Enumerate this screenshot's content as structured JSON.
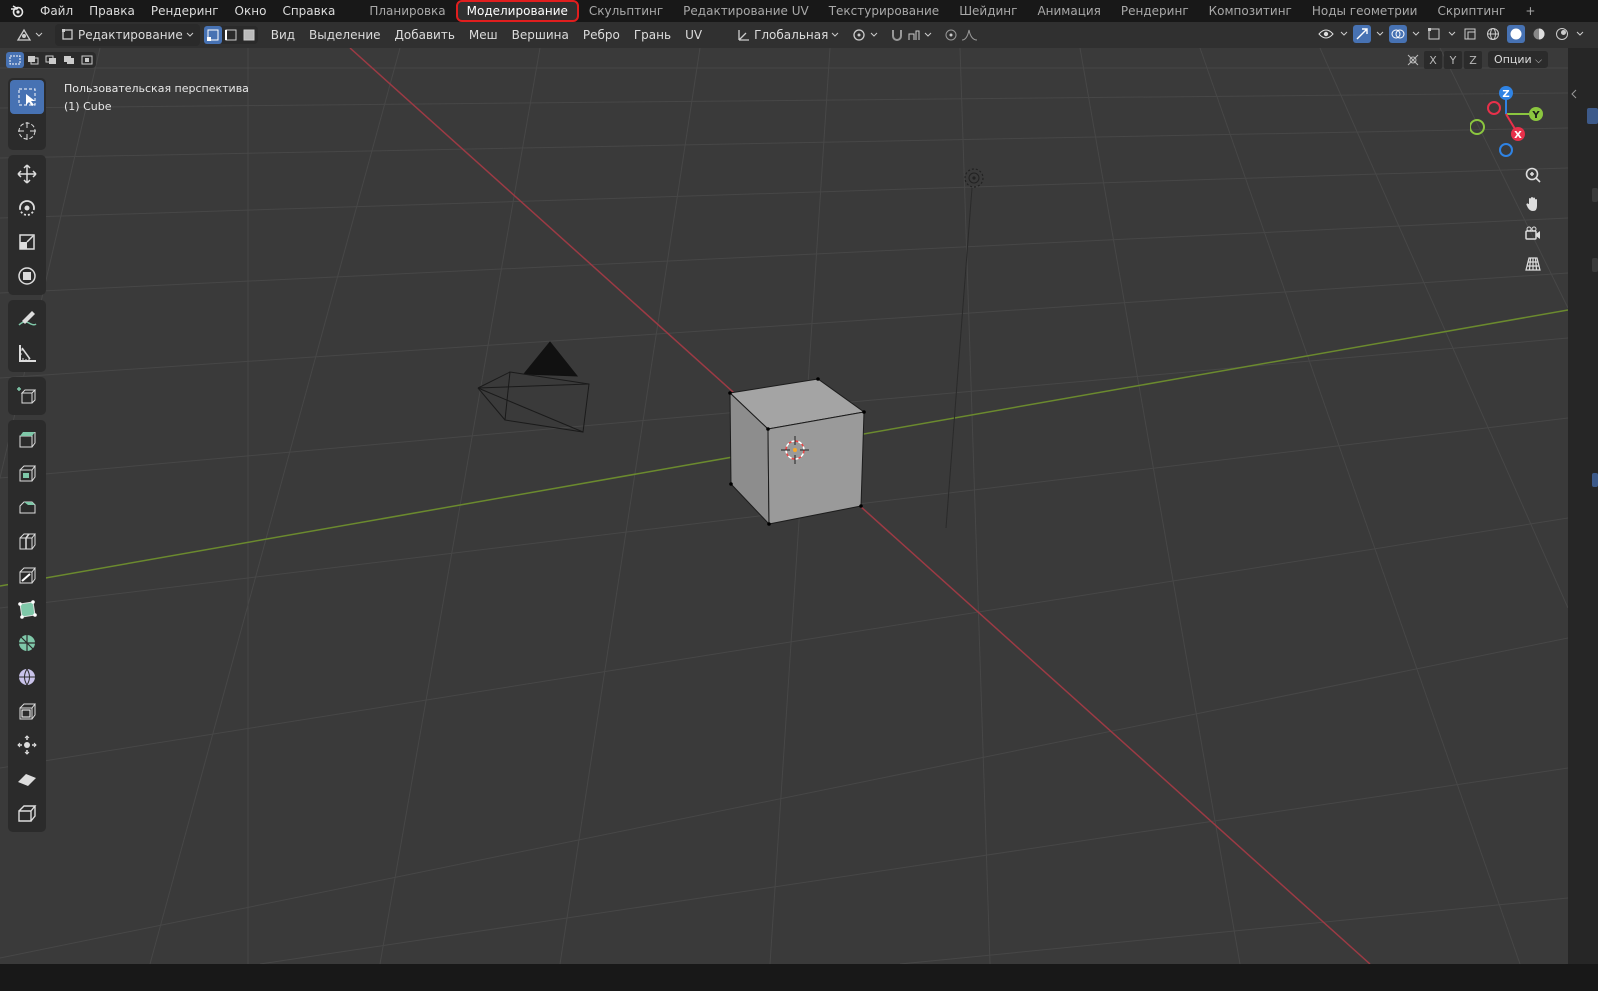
{
  "topbar": {
    "menu": [
      "Файл",
      "Правка",
      "Рендеринг",
      "Окно",
      "Справка"
    ],
    "tabs": [
      "Планировка",
      "Моделирование",
      "Скульптинг",
      "Редактирование UV",
      "Текстурирование",
      "Шейдинг",
      "Анимация",
      "Рендеринг",
      "Композитинг",
      "Ноды геометрии",
      "Скриптинг"
    ],
    "active_tab": "Моделирование",
    "add_tab": "+"
  },
  "header": {
    "mode": "Редактирование",
    "menu": [
      "Вид",
      "Выделение",
      "Добавить",
      "Меш",
      "Вершина",
      "Ребро",
      "Грань",
      "UV"
    ],
    "orientation": "Глобальная"
  },
  "viewport": {
    "view_name": "Пользовательская перспектива",
    "object_name": "(1) Cube",
    "axis_buttons": [
      "X",
      "Y",
      "Z"
    ],
    "options_label": "Опции"
  },
  "gizmo": {
    "x_label": "X",
    "y_label": "Y",
    "z_label": "Z",
    "x_color": "#e8304a",
    "y_color": "#8bc63f",
    "z_color": "#2f83e4"
  },
  "colors": {
    "accent": "#4772b3",
    "highlight": "#e01e1e",
    "viewport_bg": "#3a3a3a"
  }
}
